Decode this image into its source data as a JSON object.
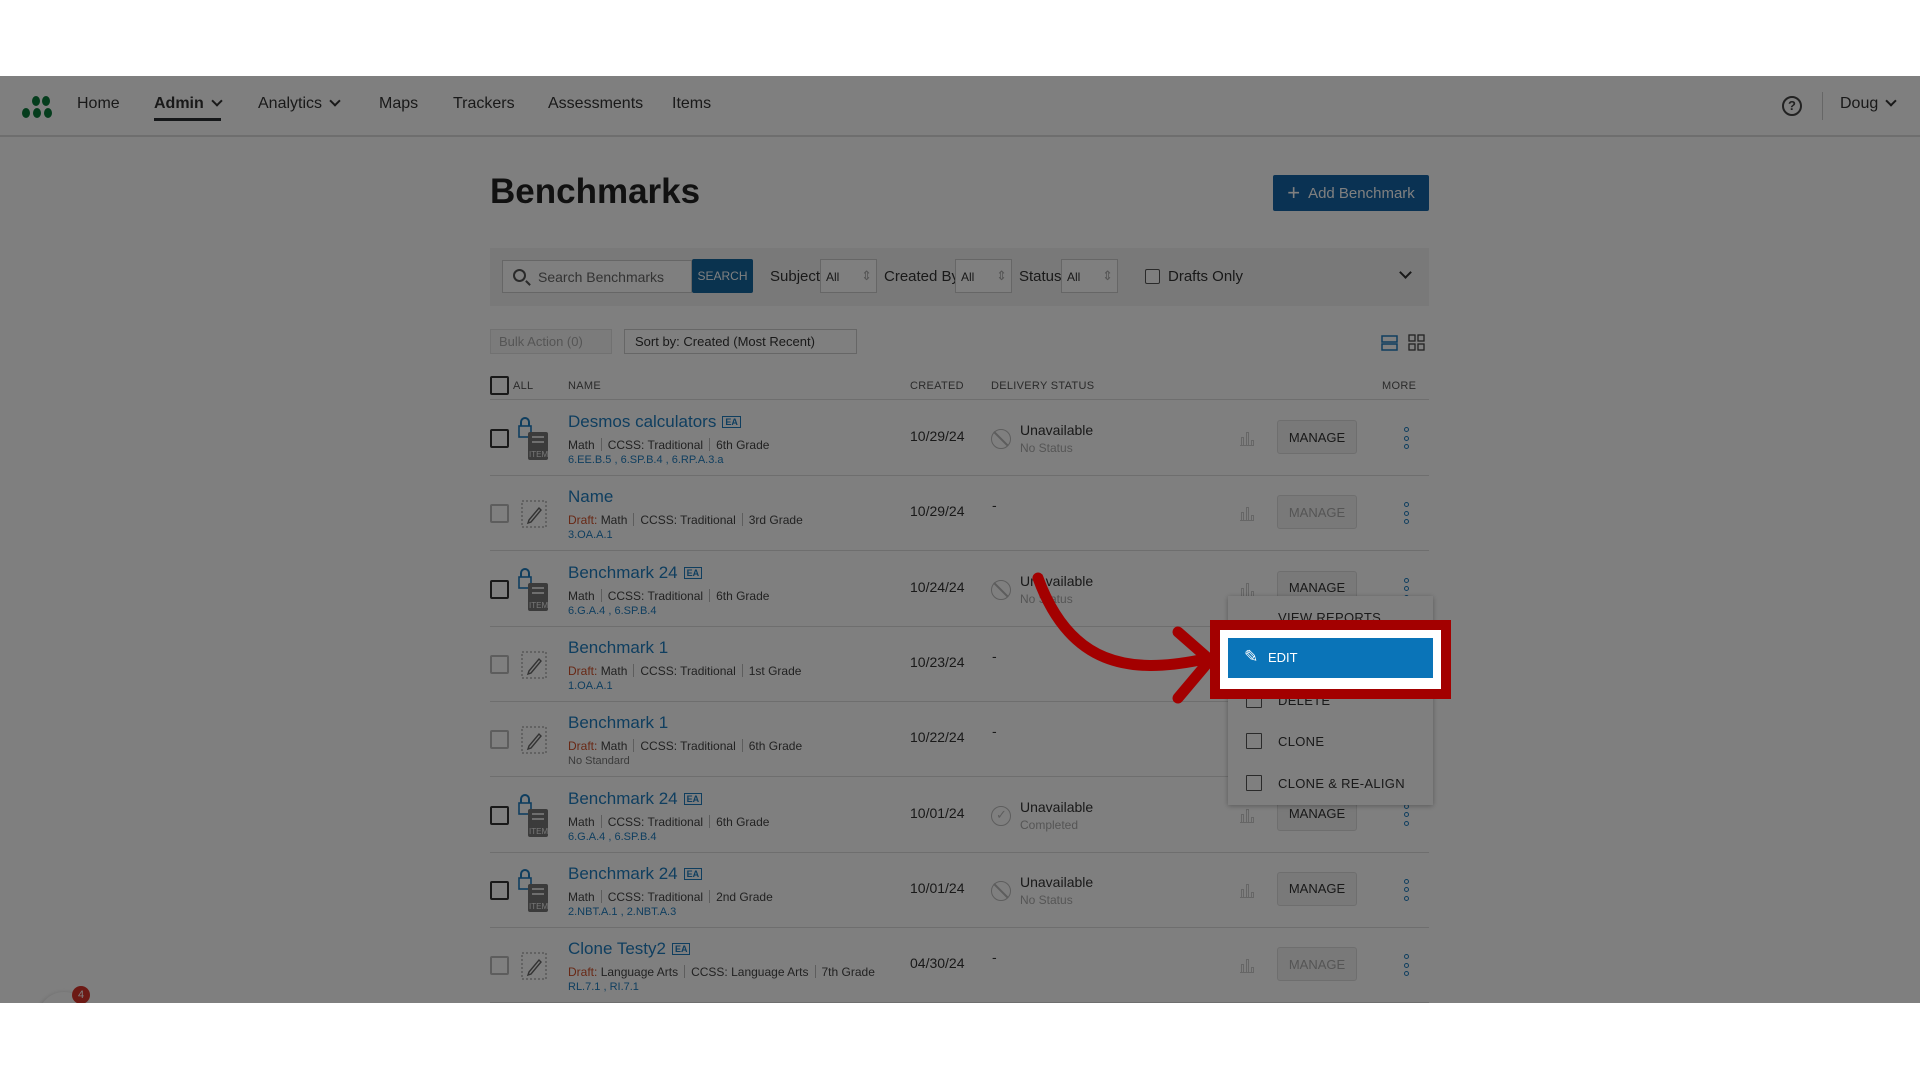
{
  "nav": {
    "items": [
      "Home",
      "Admin",
      "Analytics",
      "Maps",
      "Trackers",
      "Assessments",
      "Items"
    ],
    "active": "Admin",
    "user": "Doug",
    "help_icon": "question-circle-icon"
  },
  "page": {
    "title": "Benchmarks",
    "add_button": "Add Benchmark"
  },
  "filters": {
    "search_placeholder": "Search Benchmarks",
    "search_button": "SEARCH",
    "subject_label": "Subject",
    "subject_value": "All",
    "created_by_label": "Created By",
    "created_by_value": "All",
    "status_label": "Status",
    "status_value": "All",
    "drafts_only": "Drafts Only"
  },
  "toolbar": {
    "bulk_action": "Bulk Action (0)",
    "sort": "Sort by: Created (Most Recent)"
  },
  "table": {
    "headers": {
      "all": "ALL",
      "name": "NAME",
      "created": "CREATED",
      "delivery": "DELIVERY STATUS",
      "more": "MORE"
    },
    "manage_label": "MANAGE",
    "draft_label": "Draft:",
    "ea_badge": "EA",
    "rows": [
      {
        "name": "Desmos calculators",
        "ea": true,
        "draft": false,
        "meta": [
          "Math",
          "CCSS: Traditional",
          "6th Grade"
        ],
        "standards": "6.EE.B.5 , 6.SP.B.4 , 6.RP.A.3.a",
        "created": "10/29/24",
        "status": "Unavailable",
        "substatus": "No Status",
        "status_icon": "no"
      },
      {
        "name": "Name",
        "ea": false,
        "draft": true,
        "meta": [
          "Math",
          "CCSS: Traditional",
          "3rd Grade"
        ],
        "standards": "3.OA.A.1",
        "created": "10/29/24",
        "status": "-",
        "substatus": "",
        "status_icon": ""
      },
      {
        "name": "Benchmark 24",
        "ea": true,
        "draft": false,
        "meta": [
          "Math",
          "CCSS: Traditional",
          "6th Grade"
        ],
        "standards": "6.G.A.4 , 6.SP.B.4",
        "created": "10/24/24",
        "status": "Unavailable",
        "substatus": "No Status",
        "status_icon": "no"
      },
      {
        "name": "Benchmark 1",
        "ea": false,
        "draft": true,
        "meta": [
          "Math",
          "CCSS: Traditional",
          "1st Grade"
        ],
        "standards": "1.OA.A.1",
        "created": "10/23/24",
        "status": "-",
        "substatus": "",
        "status_icon": ""
      },
      {
        "name": "Benchmark 1",
        "ea": false,
        "draft": true,
        "meta": [
          "Math",
          "CCSS: Traditional",
          "6th Grade"
        ],
        "standards": "No Standard",
        "created": "10/22/24",
        "status": "-",
        "substatus": "",
        "status_icon": ""
      },
      {
        "name": "Benchmark 24",
        "ea": true,
        "draft": false,
        "meta": [
          "Math",
          "CCSS: Traditional",
          "6th Grade"
        ],
        "standards": "6.G.A.4 , 6.SP.B.4",
        "created": "10/01/24",
        "status": "Unavailable",
        "substatus": "Completed",
        "status_icon": "ok"
      },
      {
        "name": "Benchmark 24",
        "ea": true,
        "draft": false,
        "meta": [
          "Math",
          "CCSS: Traditional",
          "2nd Grade"
        ],
        "standards": "2.NBT.A.1 , 2.NBT.A.3",
        "created": "10/01/24",
        "status": "Unavailable",
        "substatus": "No Status",
        "status_icon": "no"
      },
      {
        "name": "Clone Testy2",
        "ea": true,
        "draft": true,
        "meta": [
          "Language Arts",
          "CCSS: Language Arts",
          "7th Grade"
        ],
        "standards": "RL.7.1 , RI.7.1",
        "created": "04/30/24",
        "status": "-",
        "substatus": "",
        "status_icon": ""
      }
    ]
  },
  "menu": {
    "items": [
      "VIEW REPORTS",
      "EDIT",
      "DELETE",
      "CLONE",
      "CLONE & RE-ALIGN"
    ],
    "highlighted": "EDIT"
  },
  "annotation": {
    "color": "#a30000"
  },
  "notification_badge": "4",
  "colors": {
    "brand_blue": "#1565a6",
    "link": "#1f7dbf",
    "draft": "#d0502a",
    "logo_green": "#0b7a3b"
  }
}
